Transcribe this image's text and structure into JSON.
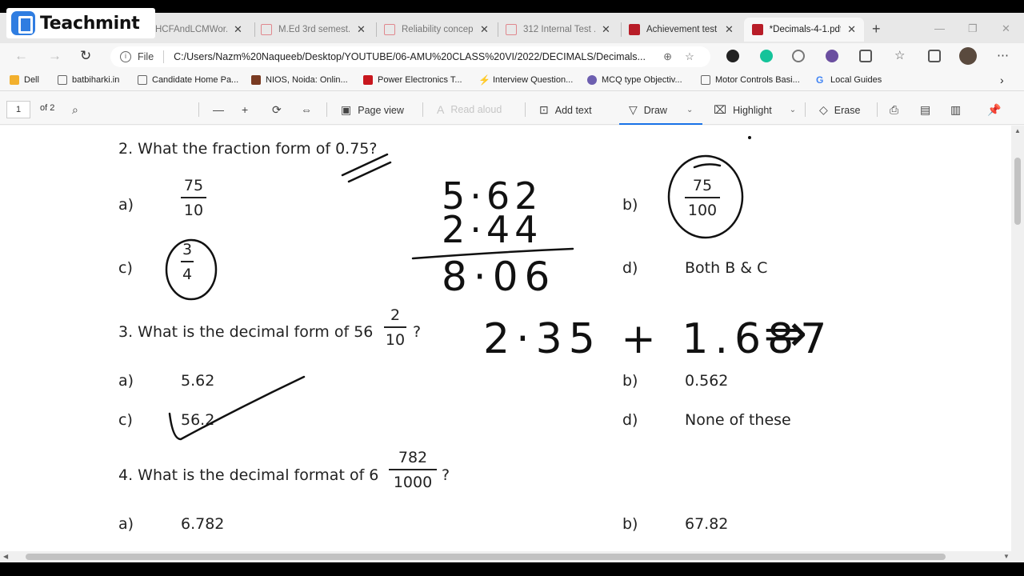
{
  "logo": {
    "text": "Teachmint"
  },
  "tabs": [
    {
      "label": "HCFAndLCMWor...",
      "icon": "doc",
      "active": false
    },
    {
      "label": "M.Ed 3rd semest...",
      "icon": "pdf-outline",
      "active": false
    },
    {
      "label": "Reliability concep...",
      "icon": "pdf-outline",
      "active": false
    },
    {
      "label": "312 Internal Test ...",
      "icon": "pdf-outline",
      "active": false
    },
    {
      "label": "Achievement test",
      "icon": "pdf",
      "active": false
    },
    {
      "label": "*Decimals-4-1.pdf",
      "icon": "pdf",
      "active": true
    }
  ],
  "address": {
    "scheme_label": "File",
    "url": "C:/Users/Nazm%20Naqueeb/Desktop/YOUTUBE/06-AMU%20CLASS%20VI/2022/DECIMALS/Decimals..."
  },
  "bookmarks": [
    {
      "label": "Dell",
      "icon": "folder-icon",
      "color": "#f2b02e"
    },
    {
      "label": "batbiharki.in",
      "icon": "page-icon",
      "color": "#666666"
    },
    {
      "label": "Candidate Home Pa...",
      "icon": "page-icon",
      "color": "#666666"
    },
    {
      "label": "NIOS, Noida: Onlin...",
      "icon": "nios-icon",
      "color": "#7a3b22"
    },
    {
      "label": "Power Electronics T...",
      "icon": "job-icon",
      "color": "#c8171e"
    },
    {
      "label": "Interview Question...",
      "icon": "bolt-icon",
      "color": "#e8a317"
    },
    {
      "label": "MCQ type Objectiv...",
      "icon": "mcq-icon",
      "color": "#6d5fb0"
    },
    {
      "label": "Motor Controls Basi...",
      "icon": "page-icon",
      "color": "#666666"
    },
    {
      "label": "Local Guides",
      "icon": "google-icon",
      "color": "#4285f4"
    }
  ],
  "pdf_toolbar": {
    "page_number": "1",
    "page_total": "of 2",
    "page_view": "Page view",
    "read_aloud": "Read aloud",
    "add_text": "Add text",
    "draw": "Draw",
    "highlight": "Highlight",
    "erase": "Erase"
  },
  "document": {
    "q2": {
      "question": "2. What the fraction form of 0.75?",
      "a_label": "a)",
      "a_num": "75",
      "a_den": "10",
      "b_label": "b)",
      "b_num": "75",
      "b_den": "100",
      "c_label": "c)",
      "c_num": "3",
      "c_den": "4",
      "d_label": "d)",
      "d_text": "Both B & C"
    },
    "q3": {
      "question_prefix": "3. What is the decimal form of 56",
      "frac_num": "2",
      "frac_den": "10",
      "question_suffix": "?",
      "a_label": "a)",
      "a_text": "5.62",
      "b_label": "b)",
      "b_text": "0.562",
      "c_label": "c)",
      "c_text": "56.2",
      "d_label": "d)",
      "d_text": "None of these"
    },
    "q4": {
      "question_prefix": "4. What is the decimal format of 6",
      "frac_num": "782",
      "frac_den": "1000",
      "question_suffix": "?",
      "a_label": "a)",
      "a_text": "6.782",
      "b_label": "b)",
      "b_text": "67.82"
    },
    "handwriting": {
      "line1": "5·62",
      "line2": "2·44",
      "result": "8·06",
      "expression": "2·35 + 1.687",
      "arrow": "⇒"
    }
  }
}
